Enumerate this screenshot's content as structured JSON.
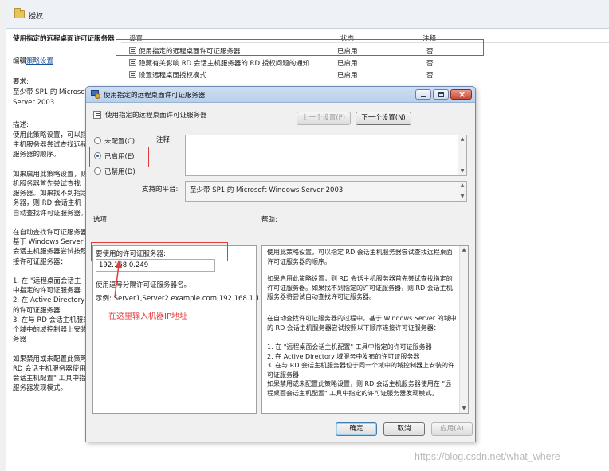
{
  "editor": {
    "folder_title": "授权",
    "setting_heading": "使用指定的远程桌面许可证服务器",
    "edit_prefix": "编辑",
    "edit_link": "策略设置",
    "requirement_label": "要求:",
    "requirement_lines": [
      "至少带 SP1 的 Microsof",
      "Server 2003"
    ],
    "description_label": "描述:",
    "description_lines": [
      "使用此策略设置，可以指",
      "主机服务器尝试查找远程",
      "服务器的顺序。",
      "",
      "如果启用此策略设置，则",
      "机服务器首先尝试查找",
      "服务器。如果找不到指定",
      "务器，则 RD 会话主机",
      "自动查找许可证服务器。",
      "",
      "在自动查找许可证服务器",
      "基于 Windows Server 的",
      "会话主机服务器尝试按照",
      "接许可证服务器：",
      "",
      "1. 在 \"远程桌面会话主",
      "中指定的许可证服务器",
      "2. 在 Active Directory 域",
      "的许可证服务器",
      "3. 在与 RD 会话主机服务",
      "个域中的域控制器上安装",
      "务器",
      "",
      "如果禁用或未配置此策略",
      "RD 会话主机服务器使用",
      "会话主机配置\" 工具中指",
      "服务器发现模式。"
    ],
    "columns": {
      "setting": "设置",
      "state": "状态",
      "note": "注释"
    },
    "rows": [
      {
        "name": "使用指定的远程桌面许可证服务器",
        "state": "已启用",
        "note": "否"
      },
      {
        "name": "隐藏有关影响 RD 会话主机服务器的 RD 授权问题的通知",
        "state": "已启用",
        "note": "否"
      },
      {
        "name": "设置远程桌面授权模式",
        "state": "已启用",
        "note": "否"
      }
    ]
  },
  "dialog": {
    "title": "使用指定的远程桌面许可证服务器",
    "header_title": "使用指定的远程桌面许可证服务器",
    "prev_button": "上一个设置(P)",
    "next_button": "下一个设置(N)",
    "radio_not_configured": "未配置(C)",
    "radio_enabled": "已启用(E)",
    "radio_disabled": "已禁用(D)",
    "comment_label": "注释:",
    "supported_label": "支持的平台:",
    "supported_value": "至少带 SP1 的 Microsoft Windows Server 2003",
    "options_label": "选项:",
    "help_label": "帮助:",
    "license_server_label": "要使用的许可证服务器:",
    "license_server_value": "192.168.0.249",
    "separator_hint": "使用逗号分隔许可证服务器名。",
    "example": "示例: Server1,Server2.example.com,192.168.1.1",
    "help_paragraphs": [
      "使用此策略设置，可以指定 RD 会话主机服务器尝试查找远程桌面许可证服务器的顺序。",
      "如果启用此策略设置，则 RD 会话主机服务器首先尝试查找指定的许可证服务器。如果找不到指定的许可证服务器，则 RD 会话主机服务器将尝试自动查找许可证服务器。",
      "在自动查找许可证服务器的过程中，基于 Windows Server 的域中的 RD 会话主机服务器尝试按照以下顺序连接许可证服务器：",
      "1. 在 \"远程桌面会话主机配置\" 工具中指定的许可证服务器\n2. 在 Active Directory 域服务中发布的许可证服务器\n3. 在与 RD 会话主机服务器位于同一个域中的域控制器上安装的许可证服务器",
      "如果禁用或未配置此策略设置，则 RD 会话主机服务器使用在 \"远程桌面会话主机配置\" 工具中指定的许可证服务器发现模式。"
    ],
    "ok_button": "确定",
    "cancel_button": "取消",
    "apply_button": "应用(A)"
  },
  "annotation": {
    "text": "在这里输入机器IP地址",
    "color": "#e23b3b"
  },
  "watermark": "https://blog.csdn.net/what_where"
}
